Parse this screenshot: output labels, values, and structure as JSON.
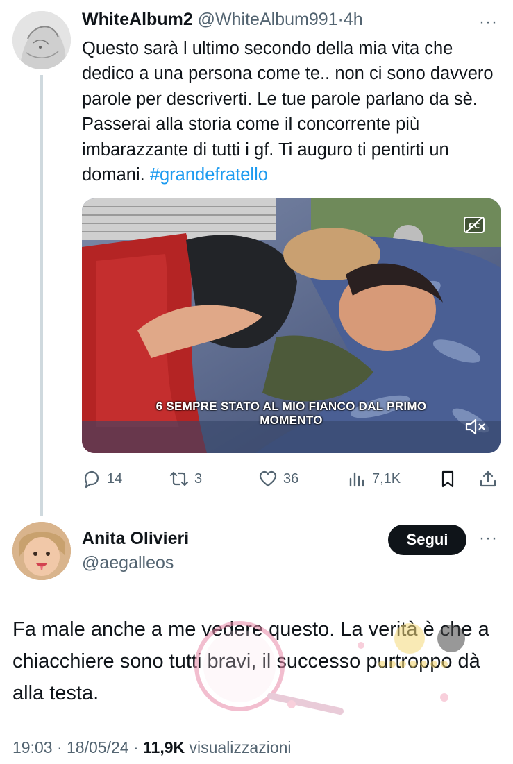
{
  "tweet": {
    "author_name": "WhiteAlbum2",
    "author_handle": "@WhiteAlbum991",
    "separator": "·",
    "time": "4h",
    "text": "Questo sarà l ultimo secondo della mia vita che dedico a una persona come te.. non ci sono davvero parole per descriverti. Le tue parole parlano da sè. Passerai alla storia come il concorrente più imbarazzante di tutti i gf. Ti auguro ti pentirti un domani. ",
    "hashtag": "#grandefratello",
    "more_icon": "more-horizontal-icon",
    "media": {
      "subtitle_line1": "6 SEMPRE STATO AL MIO FIANCO DAL PRIMO",
      "subtitle_line2": "MOMENTO",
      "cc_icon": "closed-captions-icon",
      "mute_icon": "muted-speaker-icon"
    },
    "actions": {
      "replies": "14",
      "retweets": "3",
      "likes": "36",
      "views": "7,1K"
    }
  },
  "reply": {
    "author_name": "Anita Olivieri",
    "author_handle": "@aegalleos",
    "follow_label": "Segui",
    "text": "Fa male anche a me vedere questo. La verità è che a chiacchiere sono tutti bravi, il successo purtroppo dà alla testa.",
    "time": "19:03",
    "date": "18/05/24",
    "views_count": "11,9K",
    "views_label": "visualizzazioni",
    "separator": "·"
  },
  "colors": {
    "text": "#0f1419",
    "secondary": "#536471",
    "link": "#1d9bf0",
    "button_bg": "#0f1419",
    "thread_line": "#cfd9de"
  }
}
